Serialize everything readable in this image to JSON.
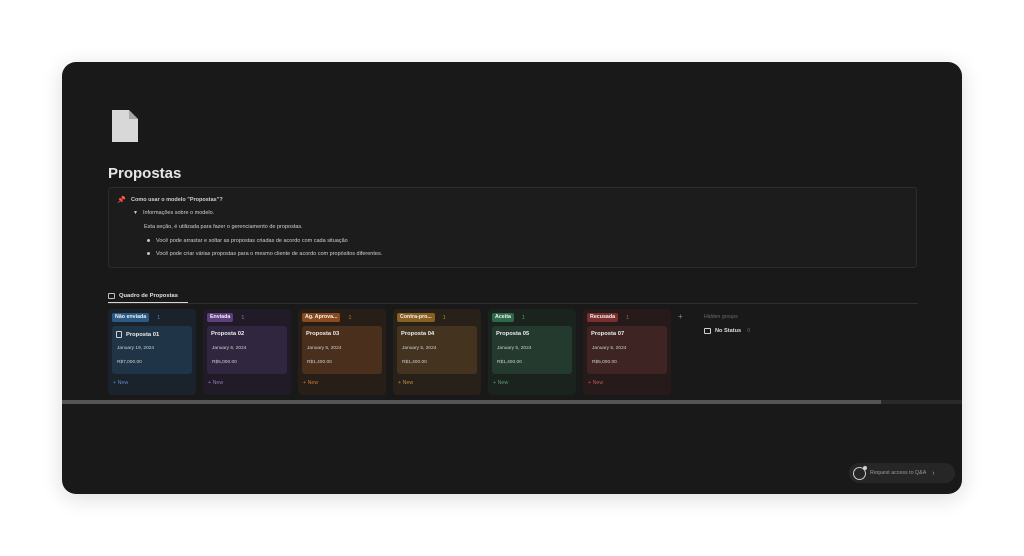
{
  "page": {
    "title": "Propostas",
    "icon": "document-icon"
  },
  "callout": {
    "icon": "pushpin-icon",
    "heading": "Como usar o modelo \"Propostas\"?",
    "toggle_label": "Informações sobre o modelo.",
    "description": "Esta seção, é utilizada para fazer o gerenciamento de propostas.",
    "bullets": [
      "Você pode arrastar e soltar as propostas criadas de acordo com cada situação",
      "Você pode criar várias propostas para o mesmo cliente de acordo com propósitos diferentes."
    ]
  },
  "view": {
    "tab_label": "Quadro de Propostas",
    "tab_icon": "board-icon"
  },
  "board": {
    "new_label": "+ New",
    "columns": [
      {
        "status": "Não enviada",
        "count": "1",
        "chip_color": "#2a5b86",
        "col_bg": "#1a222b",
        "card_bg": "#1f3447",
        "accent": "#5b8ac4",
        "card": {
          "title": "Proposta 01",
          "date": "January 19, 2024",
          "value": "R$7,000.00",
          "has_icon": true
        }
      },
      {
        "status": "Enviada",
        "count": "1",
        "chip_color": "#5d3f80",
        "col_bg": "#201b26",
        "card_bg": "#312640",
        "accent": "#9275b8",
        "card": {
          "title": "Proposta 02",
          "date": "January 5, 2024",
          "value": "R$5,000.00",
          "has_icon": false
        }
      },
      {
        "status": "Ag. Aprova...",
        "count": "1",
        "chip_color": "#8a4b1e",
        "col_bg": "#271e17",
        "card_bg": "#4a2f1d",
        "accent": "#c07a3c",
        "card": {
          "title": "Proposta 03",
          "date": "January 5, 2024",
          "value": "R$1,400.00",
          "has_icon": false
        }
      },
      {
        "status": "Contra-pro...",
        "count": "1",
        "chip_color": "#8a6020",
        "col_bg": "#27211a",
        "card_bg": "#44341f",
        "accent": "#bd8a3c",
        "card": {
          "title": "Proposta 04",
          "date": "January 5, 2024",
          "value": "R$1,400.00",
          "has_icon": false
        }
      },
      {
        "status": "Aceita",
        "count": "1",
        "chip_color": "#2c6a4a",
        "col_bg": "#1a231e",
        "card_bg": "#243a2e",
        "accent": "#5a9a77",
        "card": {
          "title": "Proposta 05",
          "date": "January 5, 2024",
          "value": "R$1,400.00",
          "has_icon": false
        }
      },
      {
        "status": "Recusada",
        "count": "1",
        "chip_color": "#7a2f2f",
        "col_bg": "#271a1a",
        "card_bg": "#3e2423",
        "accent": "#b25b5b",
        "card": {
          "title": "Proposta 07",
          "date": "January 5, 2024",
          "value": "R$5,000.00",
          "has_icon": false
        }
      }
    ],
    "add_group_icon": "+",
    "hidden_groups_label": "Hidden groups",
    "no_status": {
      "label": "No Status",
      "count": "0",
      "icon": "inbox-icon"
    }
  },
  "request_access": {
    "label": "Request access to Q&A",
    "icon": "qa-icon"
  }
}
